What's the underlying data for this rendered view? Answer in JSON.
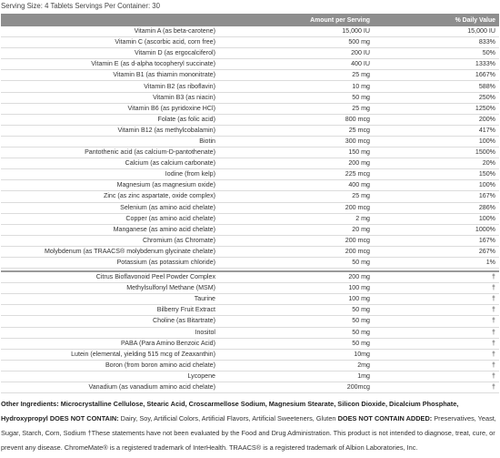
{
  "serving": "Serving Size: 4 Tablets Servings Per Container: 30",
  "headers": {
    "name": "",
    "amount": "Amount per Serving",
    "dv": "% Daily Value"
  },
  "rows": [
    {
      "name": "Vitamin A (as beta-carotene)",
      "amount": "15,000 IU",
      "dv": "15,000 IU"
    },
    {
      "name": "Vitamin C (ascorbic acid, corn free)",
      "amount": "500 mg",
      "dv": "833%"
    },
    {
      "name": "Vitamin D (as ergocalciferol)",
      "amount": "200 IU",
      "dv": "50%"
    },
    {
      "name": "Vitamin E (as d-alpha tocopheryl succinate)",
      "amount": "400 IU",
      "dv": "1333%"
    },
    {
      "name": "Vitamin B1 (as thiamin mononitrate)",
      "amount": "25 mg",
      "dv": "1667%"
    },
    {
      "name": "Vitamin B2 (as riboflavin)",
      "amount": "10 mg",
      "dv": "588%"
    },
    {
      "name": "Vitamin B3 (as niacin)",
      "amount": "50 mg",
      "dv": "250%"
    },
    {
      "name": "Vitamin B6 (as pyridoxine HCl)",
      "amount": "25 mg",
      "dv": "1250%"
    },
    {
      "name": "Folate (as folic acid)",
      "amount": "800 mcg",
      "dv": "200%"
    },
    {
      "name": "Vitamin B12 (as methylcobalamin)",
      "amount": "25 mcg",
      "dv": "417%"
    },
    {
      "name": "Biotin",
      "amount": "300 mcg",
      "dv": "100%"
    },
    {
      "name": "Pantothenic acid (as calcium-D-pantothenate)",
      "amount": "150 mg",
      "dv": "1500%"
    },
    {
      "name": "Calcium (as calcium carbonate)",
      "amount": "200 mg",
      "dv": "20%"
    },
    {
      "name": "Iodine (from kelp)",
      "amount": "225 mcg",
      "dv": "150%"
    },
    {
      "name": "Magnesium (as magnesium oxide)",
      "amount": "400 mg",
      "dv": "100%"
    },
    {
      "name": "Zinc (as zinc aspartate, oxide complex)",
      "amount": "25 mg",
      "dv": "167%"
    },
    {
      "name": "Selenium (as amino acid chelate)",
      "amount": "200 mcg",
      "dv": "286%"
    },
    {
      "name": "Copper (as amino acid chelate)",
      "amount": "2 mg",
      "dv": "100%"
    },
    {
      "name": "Manganese (as amino acid chelate)",
      "amount": "20 mg",
      "dv": "1000%"
    },
    {
      "name": "Chromium (as Chromate)",
      "amount": "200 mcg",
      "dv": "167%"
    },
    {
      "name": "Molybdenum (as TRAACS® molybdenum glycinate chelate)",
      "amount": "200 mcg",
      "dv": "267%"
    },
    {
      "name": "Potassium (as potassium chloride)",
      "amount": "50 mg",
      "dv": "1%"
    }
  ],
  "other_rows": [
    {
      "name": "Citrus Bioflavonoid Peel Powder Complex",
      "amount": "200 mg",
      "dv": "†"
    },
    {
      "name": "Methylsulfonyl Methane (MSM)",
      "amount": "100 mg",
      "dv": "†"
    },
    {
      "name": "Taurine",
      "amount": "100 mg",
      "dv": "†"
    },
    {
      "name": "Bilberry Fruit Extract",
      "amount": "50 mg",
      "dv": "†"
    },
    {
      "name": "Choline (as Bitartrate)",
      "amount": "50 mg",
      "dv": "†"
    },
    {
      "name": "Inositol",
      "amount": "50 mg",
      "dv": "†"
    },
    {
      "name": "PABA (Para Amino Benzoic Acid)",
      "amount": "50 mg",
      "dv": "†"
    },
    {
      "name": "Lutein (elemental, yielding 515 mcg of Zeaxanthin)",
      "amount": "10mg",
      "dv": "†"
    },
    {
      "name": "Boron (from boron amino acid chelate)",
      "amount": "2mg",
      "dv": "†"
    },
    {
      "name": "Lycopene",
      "amount": "1mg",
      "dv": "†"
    },
    {
      "name": "Vanadium (as vanadium amino acid chelate)",
      "amount": "200mcg",
      "dv": "†"
    }
  ],
  "footer": {
    "other_label": "Other Ingredients:",
    "other_text": "Microcrystalline Cellulose, Stearic Acid, Croscarmellose Sodium, Magnesium Stearate, Silicon Dioxide, Dicalcium Phosphate, Hydroxypropyl",
    "not_contain_label": "DOES NOT CONTAIN:",
    "not_contain_text": "Dairy, Soy, Artificial Colors, Artificial Flavors, Artificial Sweeteners, Gluten",
    "not_added_label": "DOES NOT CONTAIN ADDED:",
    "not_added_text": "Preservatives, Yeast, Sugar, Starch, Corn, Sodium",
    "disclaimer": "†These statements have not been evaluated by the Food and Drug Administration. This product is not intended to diagnose, treat, cure, or prevent any disease. ChromeMate® is a registered trademark of InterHealth. TRAACS® is a registered trademark of Albion Laboratories, Inc."
  }
}
